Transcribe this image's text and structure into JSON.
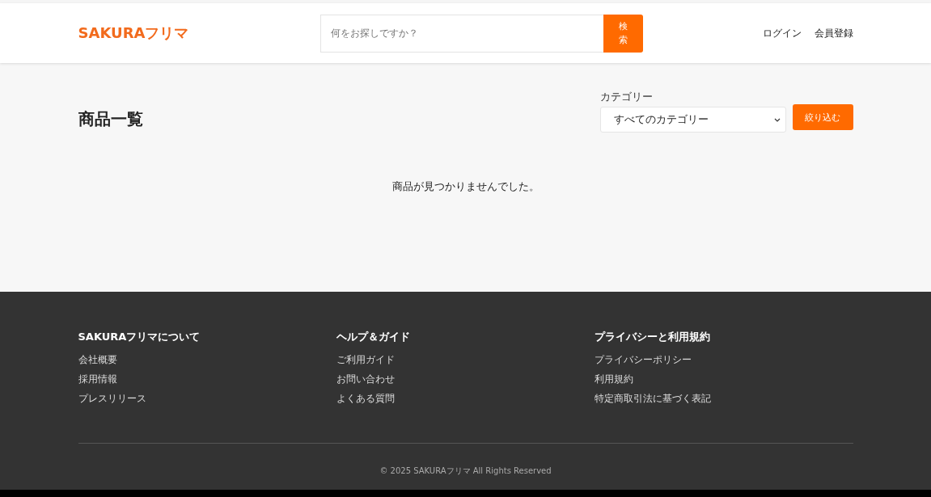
{
  "header": {
    "logo": "SAKURAフリマ",
    "search": {
      "placeholder": "何をお探しですか？",
      "button": "検索"
    },
    "nav": [
      "ログイン",
      "会員登録"
    ]
  },
  "main": {
    "title": "商品一覧",
    "filter": {
      "label": "カテゴリー",
      "value": "すべてのカテゴリー",
      "button": "絞り込む"
    },
    "empty_message": "商品が見つかりませんでした。"
  },
  "footer": {
    "columns": [
      {
        "heading": "SAKURAフリマについて",
        "links": [
          "会社概要",
          "採用情報",
          "プレスリリース"
        ]
      },
      {
        "heading": "ヘルプ＆ガイド",
        "links": [
          "ご利用ガイド",
          "お問い合わせ",
          "よくある質問"
        ]
      },
      {
        "heading": "プライバシーと利用規約",
        "links": [
          "プライバシーポリシー",
          "利用規約",
          "特定商取引法に基づく表記"
        ]
      }
    ],
    "copyright": "© 2025 SAKURAフリマ All Rights Reserved"
  }
}
